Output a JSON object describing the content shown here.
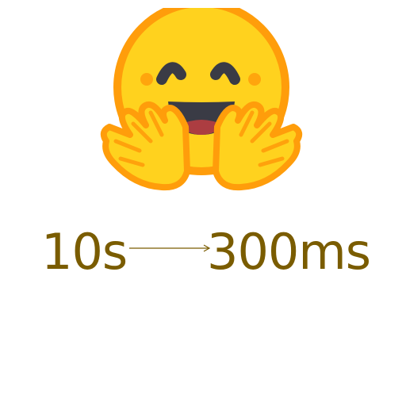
{
  "logo": {
    "icon": "hugging-face-emoji-icon",
    "colors": {
      "face": "#FFD21E",
      "outline": "#FF9D0B",
      "features": "#3A3B45",
      "cheeks": "#FF9D0B"
    }
  },
  "comparison": {
    "before": "10s",
    "after": "300ms",
    "text_color": "#7A5C00",
    "arrow_icon": "right-arrow-icon"
  }
}
